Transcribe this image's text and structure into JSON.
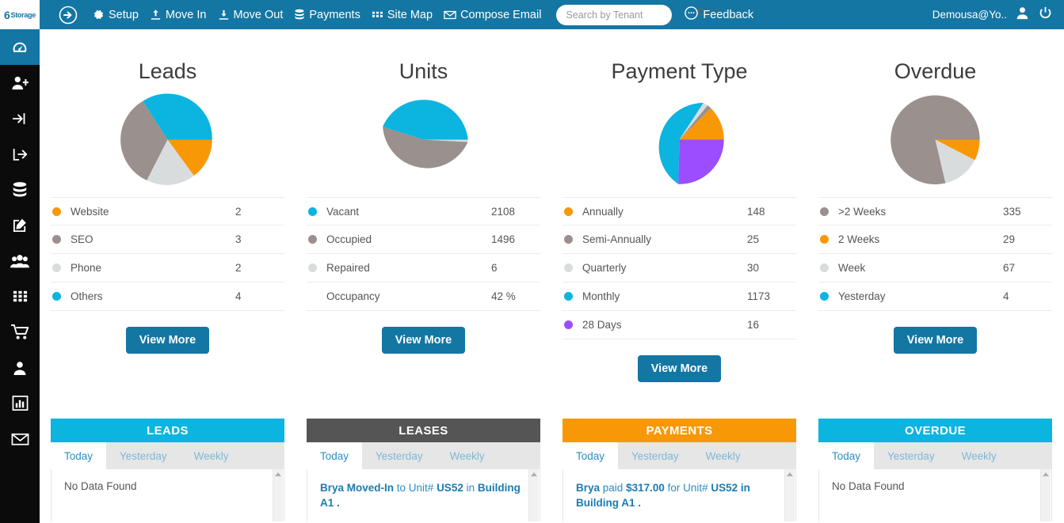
{
  "topbar": {
    "logo_text": "Storage",
    "logo_mark": "6",
    "arrow_icon": "arrow-circle-right-icon",
    "nav": [
      {
        "label": "Setup",
        "icon": "gear-icon"
      },
      {
        "label": "Move In",
        "icon": "move-in-icon"
      },
      {
        "label": "Move Out",
        "icon": "move-out-icon"
      },
      {
        "label": "Payments",
        "icon": "database-icon"
      },
      {
        "label": "Site Map",
        "icon": "grid-icon"
      },
      {
        "label": "Compose Email",
        "icon": "envelope-icon"
      }
    ],
    "search": {
      "placeholder": "Search by Tenant",
      "value": "",
      "icon": "search-icon"
    },
    "feedback": {
      "label": "Feedback",
      "icon": "comment-icon"
    },
    "user": {
      "name": "Demousa@Yo..",
      "avatar_icon": "user-icon",
      "power_icon": "power-icon"
    },
    "bg_color": "#1476a3"
  },
  "sidebar": {
    "items": [
      {
        "icon": "dashboard-icon",
        "active": true
      },
      {
        "icon": "user-plus-icon",
        "active": false
      },
      {
        "icon": "sign-in-icon",
        "active": false
      },
      {
        "icon": "sign-out-icon",
        "active": false
      },
      {
        "icon": "database-icon",
        "active": false
      },
      {
        "icon": "edit-icon",
        "active": false
      },
      {
        "icon": "users-icon",
        "active": false
      },
      {
        "icon": "grid-icon",
        "active": false
      },
      {
        "icon": "cart-icon",
        "active": false
      },
      {
        "icon": "user-icon",
        "active": false
      },
      {
        "icon": "bar-chart-icon",
        "active": false
      },
      {
        "icon": "envelope-icon",
        "active": false
      }
    ],
    "active_color": "#1476a3",
    "bg_color": "#0b0b0b"
  },
  "colors": {
    "orange": "#f99806",
    "gray": "#9a908d",
    "light_gray": "#d9dcdd",
    "cyan": "#0cb4e0",
    "purple": "#9b4dff",
    "button_blue": "#1476a3"
  },
  "panels": [
    {
      "title": "Leads",
      "button": "View More",
      "rows": [
        {
          "label": "Website",
          "value": "2",
          "color": "#f99806"
        },
        {
          "label": "SEO",
          "value": "3",
          "color": "#9a908d"
        },
        {
          "label": "Phone",
          "value": "2",
          "color": "#d9dcdd"
        },
        {
          "label": "Others",
          "value": "4",
          "color": "#0cb4e0"
        }
      ]
    },
    {
      "title": "Units",
      "button": "View More",
      "rows": [
        {
          "label": "Vacant",
          "value": "2108",
          "color": "#0cb4e0"
        },
        {
          "label": "Occupied",
          "value": "1496",
          "color": "#9a908d"
        },
        {
          "label": "Repaired",
          "value": "6",
          "color": "#d9dcdd"
        },
        {
          "label": "Occupancy",
          "value": "42 %",
          "color": null
        }
      ]
    },
    {
      "title": "Payment Type",
      "button": "View More",
      "rows": [
        {
          "label": "Annually",
          "value": "148",
          "color": "#f99806"
        },
        {
          "label": "Semi-Annually",
          "value": "25",
          "color": "#9a908d"
        },
        {
          "label": "Quarterly",
          "value": "30",
          "color": "#d9dcdd"
        },
        {
          "label": "Monthly",
          "value": "1173",
          "color": "#0cb4e0"
        },
        {
          "label": "28 Days",
          "value": "16",
          "color": "#9b4dff"
        }
      ]
    },
    {
      "title": "Overdue",
      "button": "View More",
      "rows": [
        {
          "label": ">2 Weeks",
          "value": "335",
          "color": "#9a908d"
        },
        {
          "label": "2 Weeks",
          "value": "29",
          "color": "#f99806"
        },
        {
          "label": "Week",
          "value": "67",
          "color": "#d9dcdd"
        },
        {
          "label": "Yesterday",
          "value": "4",
          "color": "#0cb4e0"
        }
      ]
    }
  ],
  "cards": [
    {
      "title": "LEADS",
      "header_color": "#0cb4e0",
      "tabs": [
        "Today",
        "Yesterday",
        "Weekly"
      ],
      "active_tab": "Today",
      "empty_text": "No Data Found",
      "entries": []
    },
    {
      "title": "LEASES",
      "header_color": "#555555",
      "tabs": [
        "Today",
        "Yesterday",
        "Weekly"
      ],
      "active_tab": "Today",
      "empty_text": "",
      "entries": [
        {
          "parts": [
            {
              "text": "Brya Moved-In",
              "bold": true
            },
            {
              "text": " to Unit# ",
              "bold": false
            },
            {
              "text": "US52",
              "bold": true
            },
            {
              "text": " in ",
              "bold": false
            },
            {
              "text": "Building A1 .",
              "bold": true
            }
          ]
        }
      ]
    },
    {
      "title": "PAYMENTS",
      "header_color": "#f99806",
      "tabs": [
        "Today",
        "Yesterday",
        "Weekly"
      ],
      "active_tab": "Today",
      "empty_text": "",
      "entries": [
        {
          "parts": [
            {
              "text": "Brya",
              "bold": true
            },
            {
              "text": " paid ",
              "bold": false
            },
            {
              "text": "$317.00",
              "bold": true
            },
            {
              "text": " for Unit# ",
              "bold": false
            },
            {
              "text": "US52 in Building A1 .",
              "bold": true
            }
          ]
        }
      ]
    },
    {
      "title": "OVERDUE",
      "header_color": "#0cb4e0",
      "tabs": [
        "Today",
        "Yesterday",
        "Weekly"
      ],
      "active_tab": "Today",
      "empty_text": "No Data Found",
      "entries": []
    }
  ],
  "chart_data": [
    {
      "type": "pie",
      "title": "Leads",
      "categories": [
        "Website",
        "SEO",
        "Phone",
        "Others"
      ],
      "values": [
        2,
        3,
        2,
        4
      ],
      "colors": [
        "#f99806",
        "#9a908d",
        "#d9dcdd",
        "#0cb4e0"
      ],
      "draw_order": [
        "Website",
        "Phone",
        "SEO",
        "Others"
      ],
      "legend": "below"
    },
    {
      "type": "pie",
      "title": "Units",
      "categories": [
        "Vacant",
        "Occupied",
        "Repaired"
      ],
      "values": [
        2108,
        1496,
        6
      ],
      "colors": [
        "#0cb4e0",
        "#9a908d",
        "#d9dcdd"
      ],
      "draw_order": [
        "Repaired",
        "Occupied",
        "Vacant"
      ],
      "annotation": "Occupancy 42 %",
      "legend": "below"
    },
    {
      "type": "pie",
      "title": "Payment Type",
      "categories": [
        "Annually",
        "Semi-Annually",
        "Quarterly",
        "Monthly",
        "28 Days"
      ],
      "values": [
        148,
        25,
        30,
        1173,
        16
      ],
      "colors": [
        "#f99806",
        "#9a908d",
        "#d9dcdd",
        "#0cb4e0",
        "#9b4dff"
      ],
      "draw_order": [
        "Annually",
        "Semi-Annually",
        "Quarterly",
        "Monthly",
        "28 Days"
      ],
      "legend": "below"
    },
    {
      "type": "pie",
      "title": "Overdue",
      "categories": [
        ">2 Weeks",
        "2 Weeks",
        "Week",
        "Yesterday"
      ],
      "values": [
        335,
        29,
        67,
        4
      ],
      "colors": [
        "#9a908d",
        "#f99806",
        "#d9dcdd",
        "#0cb4e0"
      ],
      "draw_order": [
        "Yesterday",
        "2 Weeks",
        "Week",
        ">2 Weeks"
      ],
      "legend": "below"
    }
  ]
}
